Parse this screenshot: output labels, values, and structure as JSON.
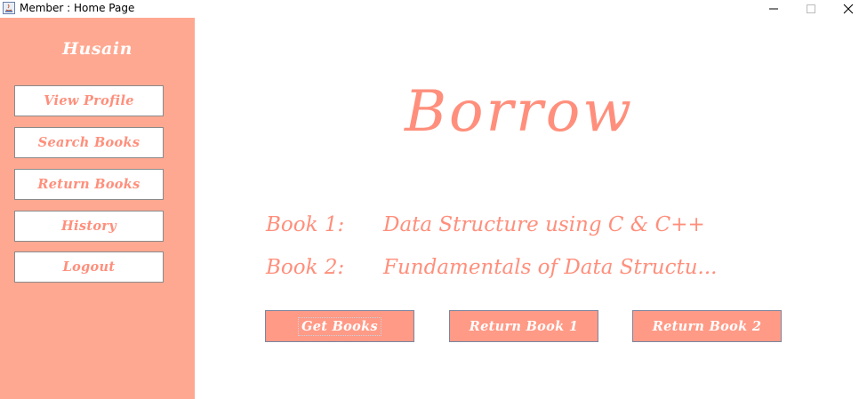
{
  "window": {
    "title": "Member : Home Page",
    "controls": {
      "minimize": "minimize-icon",
      "maximize": "maximize-icon",
      "close": "close-icon"
    }
  },
  "colors": {
    "sidebar_bg": "#ffa891",
    "accent": "#ff8f7c",
    "button_bg": "#ff9a86"
  },
  "sidebar": {
    "username": "Husain",
    "items": [
      {
        "label": "View Profile"
      },
      {
        "label": "Search Books"
      },
      {
        "label": "Return Books"
      },
      {
        "label": "History"
      },
      {
        "label": "Logout"
      }
    ]
  },
  "main": {
    "heading": "Borrow",
    "books": [
      {
        "label": "Book 1:",
        "title": "Data Structure using C & C++"
      },
      {
        "label": "Book 2:",
        "title": "Fundamentals of Data Structu..."
      }
    ],
    "buttons": {
      "get_books": "Get Books",
      "return_book_1": "Return Book 1",
      "return_book_2": "Return Book 2"
    }
  }
}
